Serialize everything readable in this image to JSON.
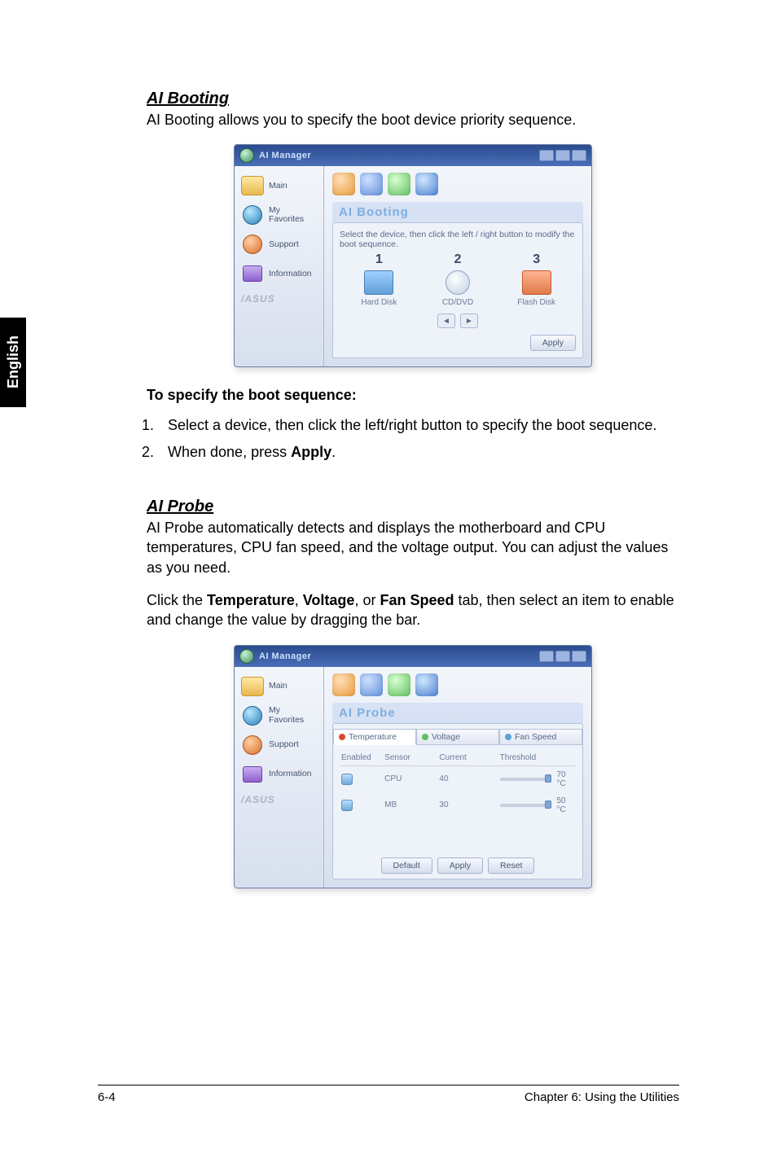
{
  "side_tab": "English",
  "section1": {
    "heading": "AI Booting",
    "intro": "AI Booting allows you to specify the boot device priority sequence.",
    "subhead": "To specify the boot sequence:",
    "steps": [
      "Select a device, then click the left/right button to specify the boot sequence.",
      {
        "pre": "When done, press ",
        "bold": "Apply",
        "post": "."
      }
    ]
  },
  "screenshot1": {
    "app_title": "AI Manager",
    "sidebar": [
      "Main",
      "My Favorites",
      "Support",
      "Information"
    ],
    "brand": "/ASUS",
    "panel_title": "AI Booting",
    "instruction": "Select the device, then click the left / right button to modify the boot sequence.",
    "slots": [
      {
        "num": "1",
        "label": "Hard Disk"
      },
      {
        "num": "2",
        "label": "CD/DVD"
      },
      {
        "num": "3",
        "label": "Flash Disk"
      }
    ],
    "apply": "Apply"
  },
  "section2": {
    "heading": "AI Probe",
    "intro": "AI Probe automatically detects and displays the motherboard and CPU temperatures, CPU fan speed, and the voltage output. You can adjust the values as you need.",
    "click_line": [
      "Click the ",
      "Temperature",
      ", ",
      "Voltage",
      ", or ",
      "Fan Speed",
      " tab, then select an item to enable and change the value by dragging the bar."
    ]
  },
  "screenshot2": {
    "app_title": "AI Manager",
    "sidebar": [
      "Main",
      "My Favorites",
      "Support",
      "Information"
    ],
    "brand": "/ASUS",
    "panel_title": "AI Probe",
    "tabs": [
      "Temperature",
      "Voltage",
      "Fan Speed"
    ],
    "columns": [
      "Enabled",
      "Sensor",
      "Current",
      "Threshold"
    ],
    "rows": [
      {
        "sensor": "CPU",
        "current": "40",
        "threshold": "70 °C"
      },
      {
        "sensor": "MB",
        "current": "30",
        "threshold": "50 °C"
      }
    ],
    "buttons": [
      "Default",
      "Apply",
      "Reset"
    ]
  },
  "footer": {
    "page": "6-4",
    "chapter": "Chapter 6: Using the Utilities"
  }
}
